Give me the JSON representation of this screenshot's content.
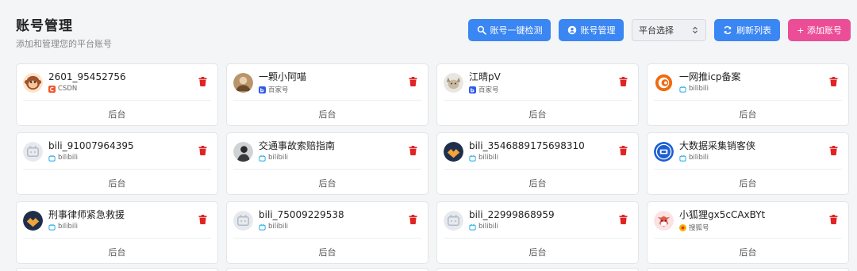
{
  "header": {
    "title": "账号管理",
    "subtitle": "添加和管理您的平台账号"
  },
  "toolbar": {
    "detect_label": "账号一键检测",
    "manage_label": "账号管理",
    "platform_select": "平台选择",
    "refresh_label": "刷新列表",
    "add_label": "+ 添加账号"
  },
  "colors": {
    "blue": "#3a86f3",
    "pink": "#ec4d97",
    "delete_red": "#e02424"
  },
  "backend_label": "后台",
  "cards": [
    {
      "name": "2601_95452756",
      "platform": "CSDN",
      "avatar": "monkey",
      "plat_color": "#f2552c",
      "plat_icon": "csdn-icon"
    },
    {
      "name": "一颗小阿喵",
      "platform": "百家号",
      "avatar": "photo-brown",
      "plat_color": "#2f5bea",
      "plat_icon": "baijiahao-icon"
    },
    {
      "name": "江晴pV",
      "platform": "百家号",
      "avatar": "dog",
      "plat_color": "#2f5bea",
      "plat_icon": "baijiahao-icon"
    },
    {
      "name": "一网推icp备案",
      "platform": "bilibili",
      "avatar": "logo-orange",
      "plat_color": "#23ade5",
      "plat_icon": "bilibili-icon"
    },
    {
      "name": "bili_91007964395",
      "platform": "bilibili",
      "avatar": "default-tv",
      "plat_color": "#23ade5",
      "plat_icon": "bilibili-icon"
    },
    {
      "name": "交通事故索赔指南",
      "platform": "bilibili",
      "avatar": "photo-dark",
      "plat_color": "#23ade5",
      "plat_icon": "bilibili-icon"
    },
    {
      "name": "bili_3546889175698310",
      "platform": "bilibili",
      "avatar": "handshake",
      "plat_color": "#23ade5",
      "plat_icon": "bilibili-icon"
    },
    {
      "name": "大数据采集销客侠",
      "platform": "bilibili",
      "avatar": "logo-blue",
      "plat_color": "#23ade5",
      "plat_icon": "bilibili-icon"
    },
    {
      "name": "刑事律师紧急救援",
      "platform": "bilibili",
      "avatar": "handshake",
      "plat_color": "#23ade5",
      "plat_icon": "bilibili-icon"
    },
    {
      "name": "bili_75009229538",
      "platform": "bilibili",
      "avatar": "default-tv",
      "plat_color": "#23ade5",
      "plat_icon": "bilibili-icon"
    },
    {
      "name": "bili_22999868959",
      "platform": "bilibili",
      "avatar": "default-tv",
      "plat_color": "#23ade5",
      "plat_icon": "bilibili-icon"
    },
    {
      "name": "小狐狸gx5cCAxBYt",
      "platform": "搜狐号",
      "avatar": "fox",
      "plat_color": "#f5b400",
      "plat_icon": "sohu-icon"
    }
  ]
}
